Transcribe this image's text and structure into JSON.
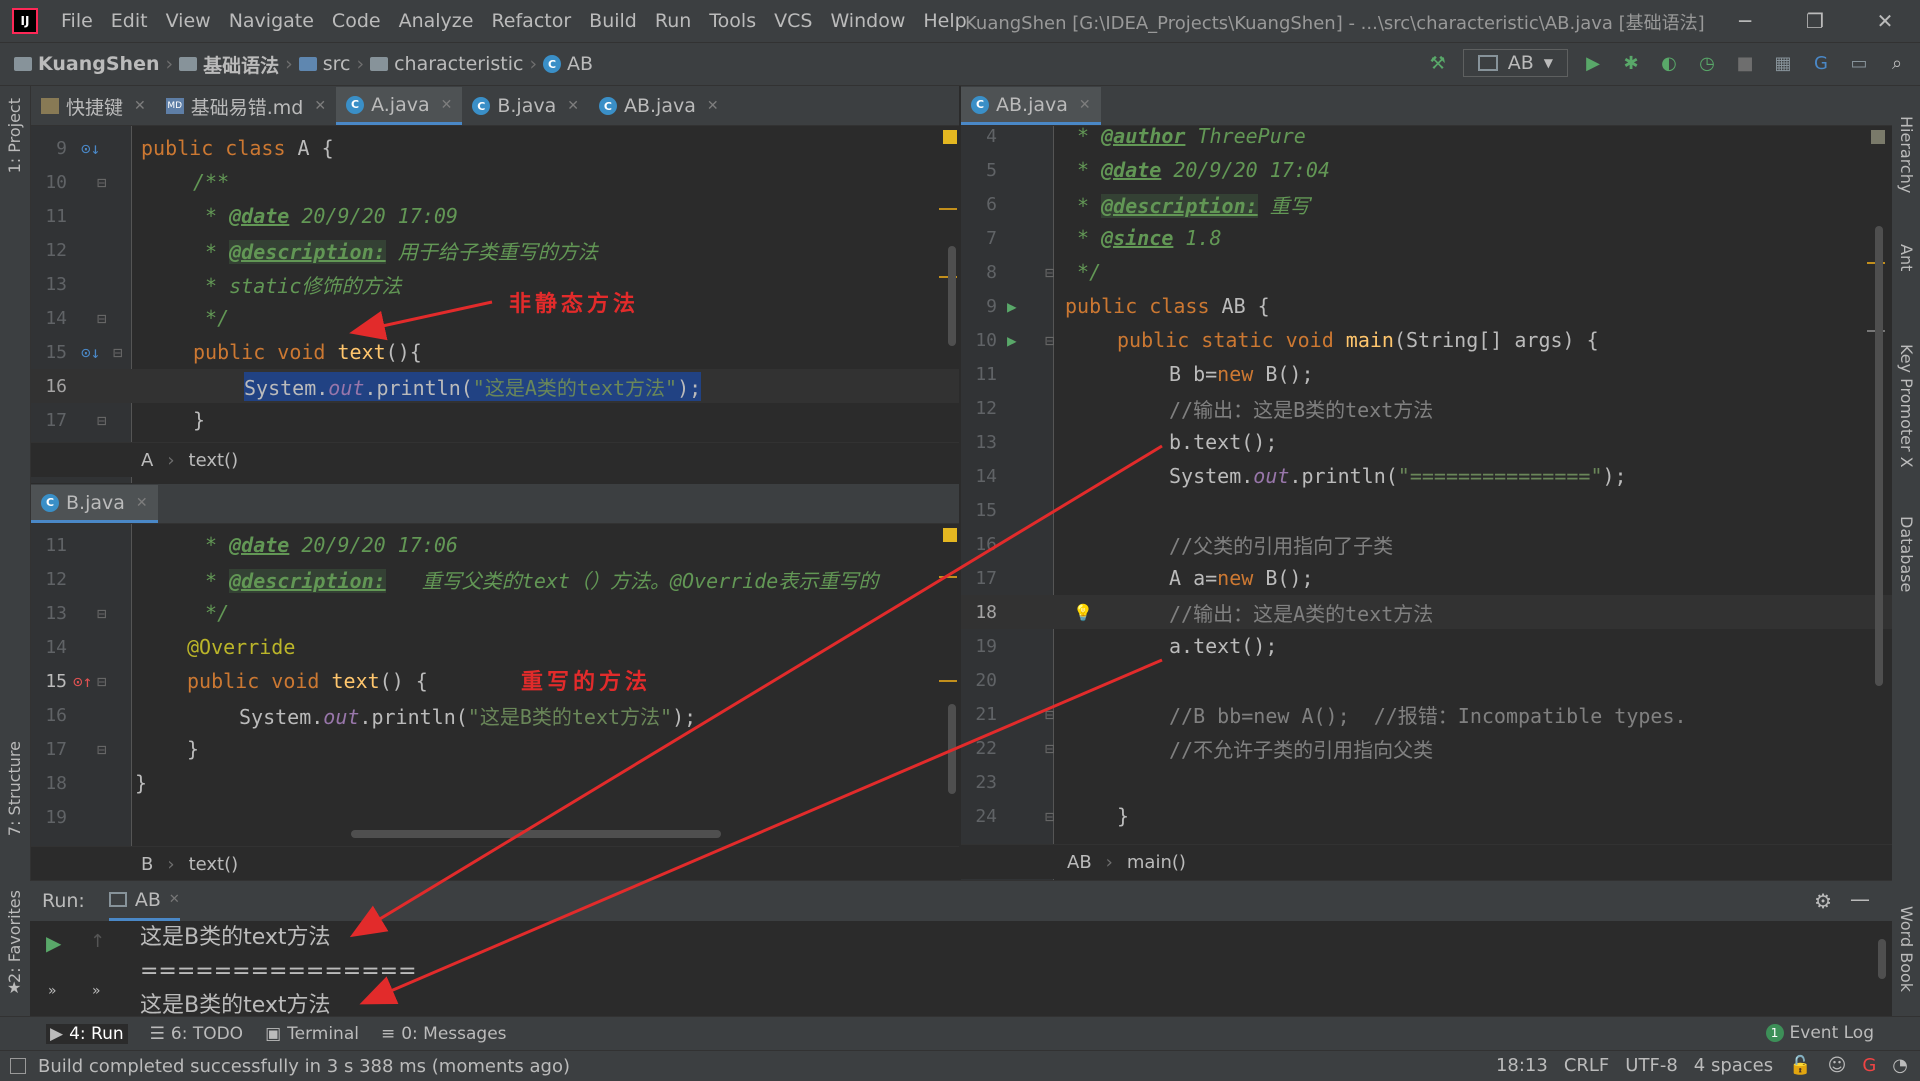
{
  "menubar": {
    "items": [
      "File",
      "Edit",
      "View",
      "Navigate",
      "Code",
      "Analyze",
      "Refactor",
      "Build",
      "Run",
      "Tools",
      "VCS",
      "Window",
      "Help"
    ],
    "title": "KuangShen [G:\\IDEA_Projects\\KuangShen] - ...\\src\\characteristic\\AB.java [基础语法]"
  },
  "navbar": {
    "crumbs": [
      "KuangShen",
      "基础语法",
      "src",
      "characteristic",
      "AB"
    ],
    "run_config": "AB"
  },
  "left_strip": {
    "project": "1: Project",
    "structure": "7: Structure",
    "favorites": "2: Favorites"
  },
  "right_strip": {
    "hierarchy": "Hierarchy",
    "ant": "Ant",
    "key_promoter": "Key Promoter X",
    "database": "Database",
    "word_book": "Word Book"
  },
  "pane_a": {
    "tabs": [
      "快捷键",
      "基础易错.md",
      "A.java",
      "B.java",
      "AB.java"
    ],
    "lines": [
      {
        "n": "9"
      },
      {
        "n": "10"
      },
      {
        "n": "11"
      },
      {
        "n": "12"
      },
      {
        "n": "13"
      },
      {
        "n": "14"
      },
      {
        "n": "15"
      },
      {
        "n": "16"
      },
      {
        "n": "17"
      }
    ],
    "code": {
      "l9_a": "public class ",
      "l9_b": "A {",
      "l10": "/**",
      "l11_star": " * ",
      "l11_tag": "@date",
      "l11_rest": " 20/9/20 17:09",
      "l12_star": " * ",
      "l12_tag": "@description:",
      "l12_rest": " 用于给子类重写的方法",
      "l13": " * static修饰的方法",
      "l14": " */",
      "l15_a": "public void ",
      "l15_fn": "text",
      "l15_b": "(){",
      "l16_a": "System.",
      "l16_fld": "out",
      "l16_b": ".println(",
      "l16_str": "\"这是A类的text方法\"",
      "l16_c": ");",
      "l17": "}"
    },
    "breadcrumb": [
      "A",
      "text()"
    ],
    "annotation": "非静态方法"
  },
  "pane_b": {
    "tab": "B.java",
    "lines": [
      {
        "n": "11"
      },
      {
        "n": "12"
      },
      {
        "n": "13"
      },
      {
        "n": "14"
      },
      {
        "n": "15"
      },
      {
        "n": "16"
      },
      {
        "n": "17"
      },
      {
        "n": "18"
      },
      {
        "n": "19"
      }
    ],
    "code": {
      "l11_star": " * ",
      "l11_tag": "@date",
      "l11_rest": " 20/9/20 17:06",
      "l12_star": " * ",
      "l12_tag": "@description:",
      "l12_rest": "   重写父类的text（）方法。@Override表示重写的",
      "l13": " */",
      "l14": "@Override",
      "l15_a": "public void ",
      "l15_fn": "text",
      "l15_b": "() {",
      "l16_a": "System.",
      "l16_fld": "out",
      "l16_b": ".println(",
      "l16_str": "\"这是B类的text方法\"",
      "l16_c": ");",
      "l17": "}",
      "l18": "}"
    },
    "breadcrumb": [
      "B",
      "text()"
    ],
    "annotation": "重写的方法"
  },
  "pane_ab": {
    "tab": "AB.java",
    "lines": [
      {
        "n": "4"
      },
      {
        "n": "5"
      },
      {
        "n": "6"
      },
      {
        "n": "7"
      },
      {
        "n": "8"
      },
      {
        "n": "9"
      },
      {
        "n": "10"
      },
      {
        "n": "11"
      },
      {
        "n": "12"
      },
      {
        "n": "13"
      },
      {
        "n": "14"
      },
      {
        "n": "15"
      },
      {
        "n": "16"
      },
      {
        "n": "17"
      },
      {
        "n": "18"
      },
      {
        "n": "19"
      },
      {
        "n": "20"
      },
      {
        "n": "21"
      },
      {
        "n": "22"
      },
      {
        "n": "23"
      },
      {
        "n": "24"
      }
    ],
    "code": {
      "l4_star": " * ",
      "l4_tag": "@author",
      "l4_rest": " ThreePure",
      "l5_star": " * ",
      "l5_tag": "@date",
      "l5_rest": " 20/9/20 17:04",
      "l6_star": " * ",
      "l6_tag": "@description:",
      "l6_rest": " 重写",
      "l7_star": " * ",
      "l7_tag": "@since",
      "l7_rest": " 1.8",
      "l8": " */",
      "l9_a": "public class ",
      "l9_b": "AB {",
      "l10_a": "public static void ",
      "l10_fn": "main",
      "l10_b": "(String[] args) {",
      "l11_a": "B b=",
      "l11_kw": "new",
      " l11_b": "",
      "l11_c": " B();",
      "l12": "//输出：这是B类的text方法",
      "l13": "b.text();",
      "l14_a": "System.",
      "l14_fld": "out",
      "l14_b": ".println(",
      "l14_str": "\"===============\"",
      "l14_c": ");",
      "l16": "//父类的引用指向了子类",
      "l17_a": "A a=",
      "l17_kw": "new",
      "l17_c": " B();",
      "l18": "//输出：这是A类的text方法",
      "l19": "a.text();",
      "l21": "//B bb=new A();  //报错：Incompatible types.",
      "l22": "//不允许子类的引用指向父类",
      "l24": "}"
    },
    "breadcrumb": [
      "AB",
      "main()"
    ]
  },
  "run": {
    "label": "Run:",
    "tab": "AB",
    "output": [
      "这是B类的text方法",
      "===============",
      "这是B类的text方法"
    ]
  },
  "toolbar": {
    "run": "4: Run",
    "todo": "6: TODO",
    "terminal": "Terminal",
    "messages": "0: Messages",
    "event_log": "Event Log",
    "event_count": "1"
  },
  "status": {
    "message": "Build completed successfully in 3 s 388 ms (moments ago)",
    "position": "18:13",
    "line_sep": "CRLF",
    "encoding": "UTF-8",
    "indent": "4 spaces"
  },
  "colors": {
    "keyword": "#cc7832",
    "string": "#6a8759",
    "method": "#ffc66d",
    "doc": "#629755",
    "annotation_red": "#e22b2b",
    "selection": "#214283"
  }
}
